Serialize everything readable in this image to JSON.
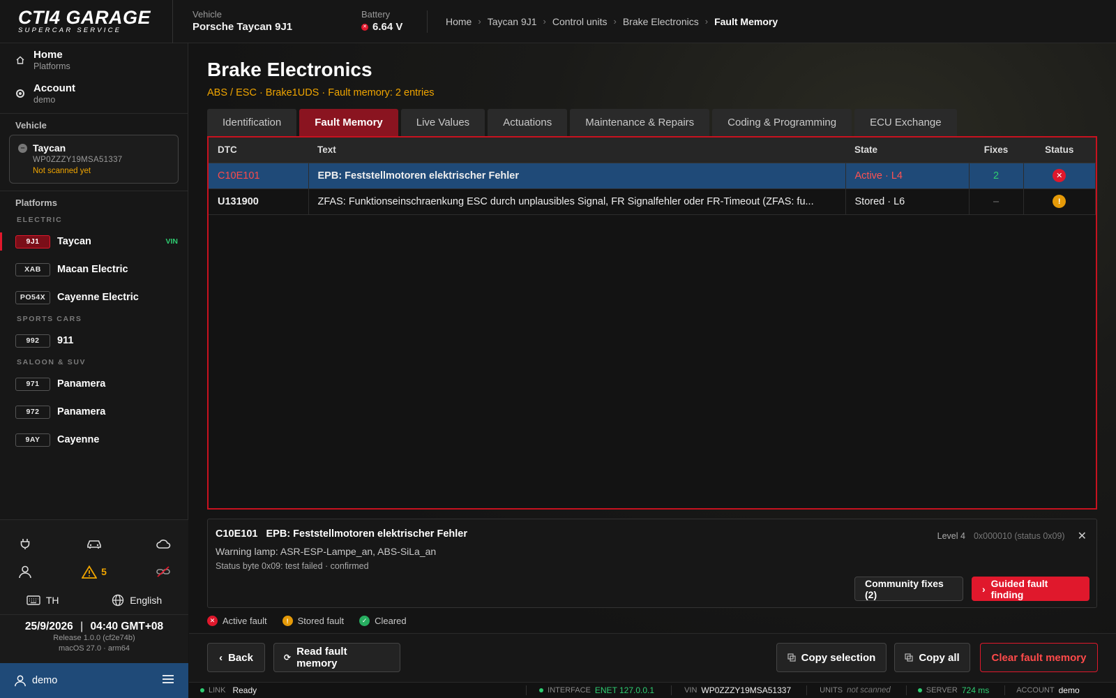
{
  "app": {
    "logo_main": "CTI4 GARAGE",
    "logo_sub": "SUPERCAR SERVICE"
  },
  "topbar": {
    "vehicle_label": "Vehicle",
    "vehicle_value": "Porsche Taycan 9J1",
    "battery_label": "Battery",
    "battery_value": "6.64 V",
    "battery_status_color": "#e0182c",
    "breadcrumb": [
      "Home",
      "Taycan 9J1",
      "Control units",
      "Brake Electronics",
      "Fault Memory"
    ]
  },
  "sidebar": {
    "home_label": "Home",
    "home_sub": "Platforms",
    "account_label": "Account",
    "account_sub": "demo",
    "vehicle_section": "Vehicle",
    "vehicle_card": {
      "name": "Taycan",
      "vin": "WP0ZZZY19MSA51337",
      "status": "Not scanned yet"
    },
    "platforms_section": "Platforms",
    "groups": [
      {
        "name": "ELECTRIC",
        "items": [
          {
            "code": "9J1",
            "name": "Taycan",
            "badge": "VIN",
            "active": true
          },
          {
            "code": "XAB",
            "name": "Macan Electric"
          },
          {
            "code": "PO54X",
            "name": "Cayenne Electric"
          }
        ]
      },
      {
        "name": "SPORTS CARS",
        "items": [
          {
            "code": "992",
            "name": "911"
          }
        ]
      },
      {
        "name": "SALOON & SUV",
        "items": [
          {
            "code": "971",
            "name": "Panamera"
          },
          {
            "code": "972",
            "name": "Panamera"
          },
          {
            "code": "9AY",
            "name": "Cayenne"
          }
        ]
      }
    ],
    "warning_count": "5",
    "keyboard": "TH",
    "language": "English",
    "date": "25/9/2026",
    "time": "04:40 GMT+08",
    "release": "Release 1.0.0 (cf2e74b)",
    "os": "macOS 27.0 · arm64",
    "user": "demo"
  },
  "main": {
    "title": "Brake Electronics",
    "subtitle": "ABS / ESC · Brake1UDS · Fault memory: 2 entries",
    "tabs": [
      "Identification",
      "Fault Memory",
      "Live Values",
      "Actuations",
      "Maintenance & Repairs",
      "Coding & Programming",
      "ECU Exchange"
    ],
    "active_tab": 1,
    "table": {
      "headers": [
        "DTC",
        "Text",
        "State",
        "Fixes",
        "Status"
      ],
      "rows": [
        {
          "dtc": "C10E101",
          "text": "EPB: Feststellmotoren elektrischer Fehler",
          "state": "Active · L4",
          "fixes": "2",
          "status": "active",
          "selected": true
        },
        {
          "dtc": "U131900",
          "text": "ZFAS: Funktionseinschraenkung ESC durch unplausibles Signal, FR Signalfehler oder FR-Timeout  (ZFAS: fu...",
          "state": "Stored · L6",
          "fixes": "–",
          "status": "stored",
          "selected": false
        }
      ]
    },
    "detail": {
      "code": "C10E101",
      "title": "EPB: Feststellmotoren elektrischer Fehler",
      "warning_lamp": "Warning lamp: ASR-ESP-Lampe_an, ABS-SiLa_an",
      "status_byte": "Status byte 0x09: test failed · confirmed",
      "level": "Level 4",
      "hex": "0x000010 (status 0x09)",
      "community_fixes": "Community fixes (2)",
      "guided": "Guided fault finding"
    },
    "legend": {
      "active": "Active fault",
      "stored": "Stored fault",
      "cleared": "Cleared"
    },
    "actions": {
      "back": "Back",
      "read": "Read fault memory",
      "copy_selection": "Copy selection",
      "copy_all": "Copy all",
      "clear": "Clear fault memory"
    },
    "statusbar": {
      "link_label": "LINK",
      "link_value": "Ready",
      "interface_label": "INTERFACE",
      "interface_value": "ENET 127.0.0.1",
      "vin_label": "VIN",
      "vin_value": "WP0ZZZY19MSA51337",
      "units_label": "UNITS",
      "units_value": "not scanned",
      "server_label": "SERVER",
      "server_value": "724 ms",
      "account_label": "ACCOUNT",
      "account_value": "demo"
    }
  },
  "colors": {
    "accent_red": "#e0182c",
    "selection_blue": "#1f4a78",
    "amber": "#f0a500",
    "green": "#2ecc71"
  }
}
